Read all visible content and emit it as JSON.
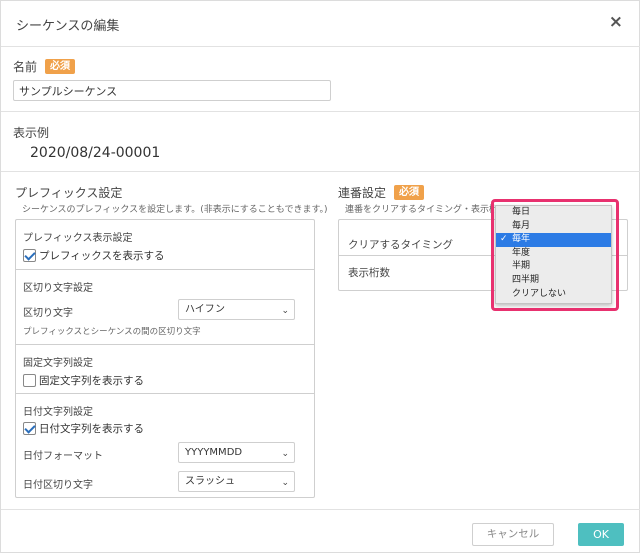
{
  "dialog": {
    "title": "シーケンスの編集",
    "close_icon": "×"
  },
  "name": {
    "label": "名前",
    "required_badge": "必須",
    "value": "サンプルシーケンス"
  },
  "example": {
    "label": "表示例",
    "value": "2020/08/24-00001"
  },
  "prefix": {
    "title": "プレフィックス設定",
    "description": "シーケンスのプレフィックスを設定します。(非表示にすることもできます。)",
    "display_group_title": "プレフィックス表示設定",
    "display_checkbox": {
      "label": "プレフィックスを表示する",
      "checked": true
    },
    "separator_group_title": "区切り文字設定",
    "separator_label": "区切り文字",
    "separator_value": "ハイフン",
    "separator_hint": "プレフィックスとシーケンスの間の区切り文字",
    "fixed_group_title": "固定文字列設定",
    "fixed_checkbox": {
      "label": "固定文字列を表示する",
      "checked": false
    },
    "date_group_title": "日付文字列設定",
    "date_checkbox": {
      "label": "日付文字列を表示する",
      "checked": true
    },
    "date_format_label": "日付フォーマット",
    "date_format_value": "YYYYMMDD",
    "date_separator_label": "日付区切り文字",
    "date_separator_value": "スラッシュ"
  },
  "serial": {
    "title": "連番設定",
    "required_badge": "必須",
    "description": "連番をクリアするタイミング・表示桁数を設定します",
    "clear_timing_label": "クリアするタイミング",
    "digits_label": "表示桁数"
  },
  "clear_timing_dropdown": {
    "options": [
      "毎日",
      "毎月",
      "毎年",
      "年度",
      "半期",
      "四半期",
      "クリアしない"
    ],
    "selected": "毎年",
    "tick": "✓"
  },
  "footer": {
    "cancel_label": "キャンセル",
    "ok_label": "OK"
  },
  "colors": {
    "required_badge": "#f0a14a",
    "ok_button": "#4ebfc0",
    "highlight_border": "#e8316f",
    "selected_option": "#2c7be5"
  },
  "icons": {
    "close": "close-icon",
    "select_chevron": "chevron-down-icon",
    "checkbox_check": "checkmark-icon"
  }
}
